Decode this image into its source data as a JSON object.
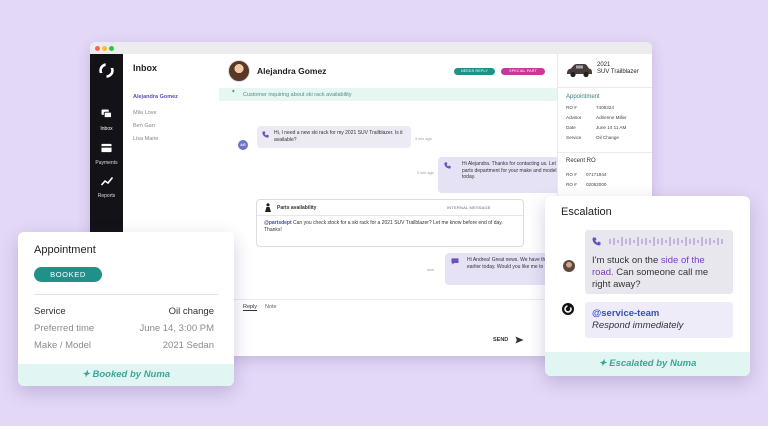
{
  "colors": {
    "background": "#e4d8f7",
    "teal": "#1f9189",
    "magenta": "#c8379c",
    "purple": "#7a3dc0",
    "rail": "#121217"
  },
  "rail": {
    "logo_icon": "numa-logo-icon",
    "items": [
      {
        "label": "Inbox",
        "icon": "chat-icon",
        "active": true
      },
      {
        "label": "Payments",
        "icon": "card-icon",
        "active": false
      },
      {
        "label": "Reports",
        "icon": "trend-icon",
        "active": false
      }
    ]
  },
  "inbox": {
    "title": "Inbox",
    "items": [
      "Alejandra Gomez",
      "Mila Love",
      "Ben Garr",
      "Lisa Marie"
    ]
  },
  "conversation": {
    "name": "Alejandra Gomez",
    "tags": [
      "NEEDS REPLY",
      "SPECIAL PART"
    ],
    "banner": "Customer inquiring about ski rack availability",
    "messages": {
      "m1": {
        "text": "Hi, I need a new ski rack for my 2021 SUV Trailblazer. Is it available?",
        "time": "3 min ago",
        "avatar": "AG"
      },
      "m2": {
        "text": "Hi Alejandra. Thanks for contacting us. Let me check with the parts department for your make and model and will back to you today.",
        "time": "2 min ago",
        "avatar": "BM"
      },
      "internal": {
        "title": "Parts availability",
        "tag": "INTERNAL MESSAGE",
        "mention": "@partsdept",
        "text": " Can you check stock for a ski rack for a 2021 SUV Trailblazer? Let me know before end of day. Thanks!"
      },
      "m3": {
        "text": "Hi Andrea! Great news. We have the ski rack you called about earlier today. Would you like me to hold that for you?",
        "time": "now",
        "avatar": "BM"
      }
    },
    "reply_tabs": [
      "Reply",
      "Note"
    ],
    "send_label": "SEND"
  },
  "vehicle": {
    "year": "2021",
    "model": "SUV Trailblazer"
  },
  "appointment_panel": {
    "title": "Appointment",
    "rows": [
      {
        "k": "RO #",
        "v": "7408324"
      },
      {
        "k": "Advisor",
        "v": "Adrienne Miller"
      },
      {
        "k": "Date",
        "v": "June 14  11 AM"
      },
      {
        "k": "Service",
        "v": "Oil Change"
      }
    ],
    "recent_title": "Recent RO",
    "recent_rows": [
      {
        "k": "RO #",
        "v": "07171944"
      },
      {
        "k": "RO #",
        "v": "02062000"
      }
    ]
  },
  "appointment_card": {
    "title": "Appointment",
    "badge": "BOOKED",
    "rows": [
      {
        "k": "Service",
        "v": "Oil change"
      },
      {
        "k": "Preferred time",
        "v": "June 14, 3:00 PM"
      },
      {
        "k": "Make / Model",
        "v": "2021 Sedan"
      }
    ],
    "footer": "Booked by Numa"
  },
  "escalation_card": {
    "title": "Escalation",
    "msg_part1": "I'm stuck on the ",
    "msg_highlight": "side of the road.",
    "msg_part2": " Can someone call me right away?",
    "team": "@service-team",
    "team_note": "Respond immediately",
    "footer": "Escalated by Numa"
  }
}
